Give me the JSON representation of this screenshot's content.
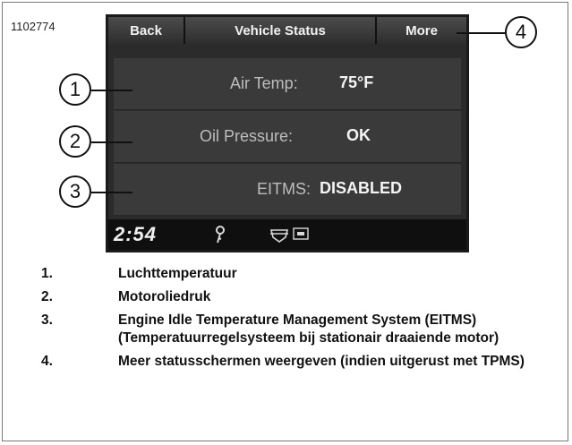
{
  "figure_id": "1102774",
  "screen": {
    "nav": {
      "back_label": "Back",
      "title": "Vehicle Status",
      "more_label": "More"
    },
    "rows": [
      {
        "label": "Air Temp:",
        "value": "75°F"
      },
      {
        "label": "Oil Pressure:",
        "value": "OK"
      },
      {
        "label": "EITMS:",
        "value": "DISABLED"
      }
    ],
    "bottom": {
      "clock": "2:54"
    }
  },
  "callouts": [
    "1",
    "2",
    "3",
    "4"
  ],
  "legend": [
    {
      "num": "1.",
      "text": "Luchttemperatuur"
    },
    {
      "num": "2.",
      "text": "Motoroliedruk"
    },
    {
      "num": "3.",
      "text": "Engine Idle Temperature Management System (EITMS) (Temperatuurregelsysteem bij stationair draaiende motor)"
    },
    {
      "num": "4.",
      "text": "Meer statusschermen weergeven (indien uitgerust met TPMS)"
    }
  ]
}
